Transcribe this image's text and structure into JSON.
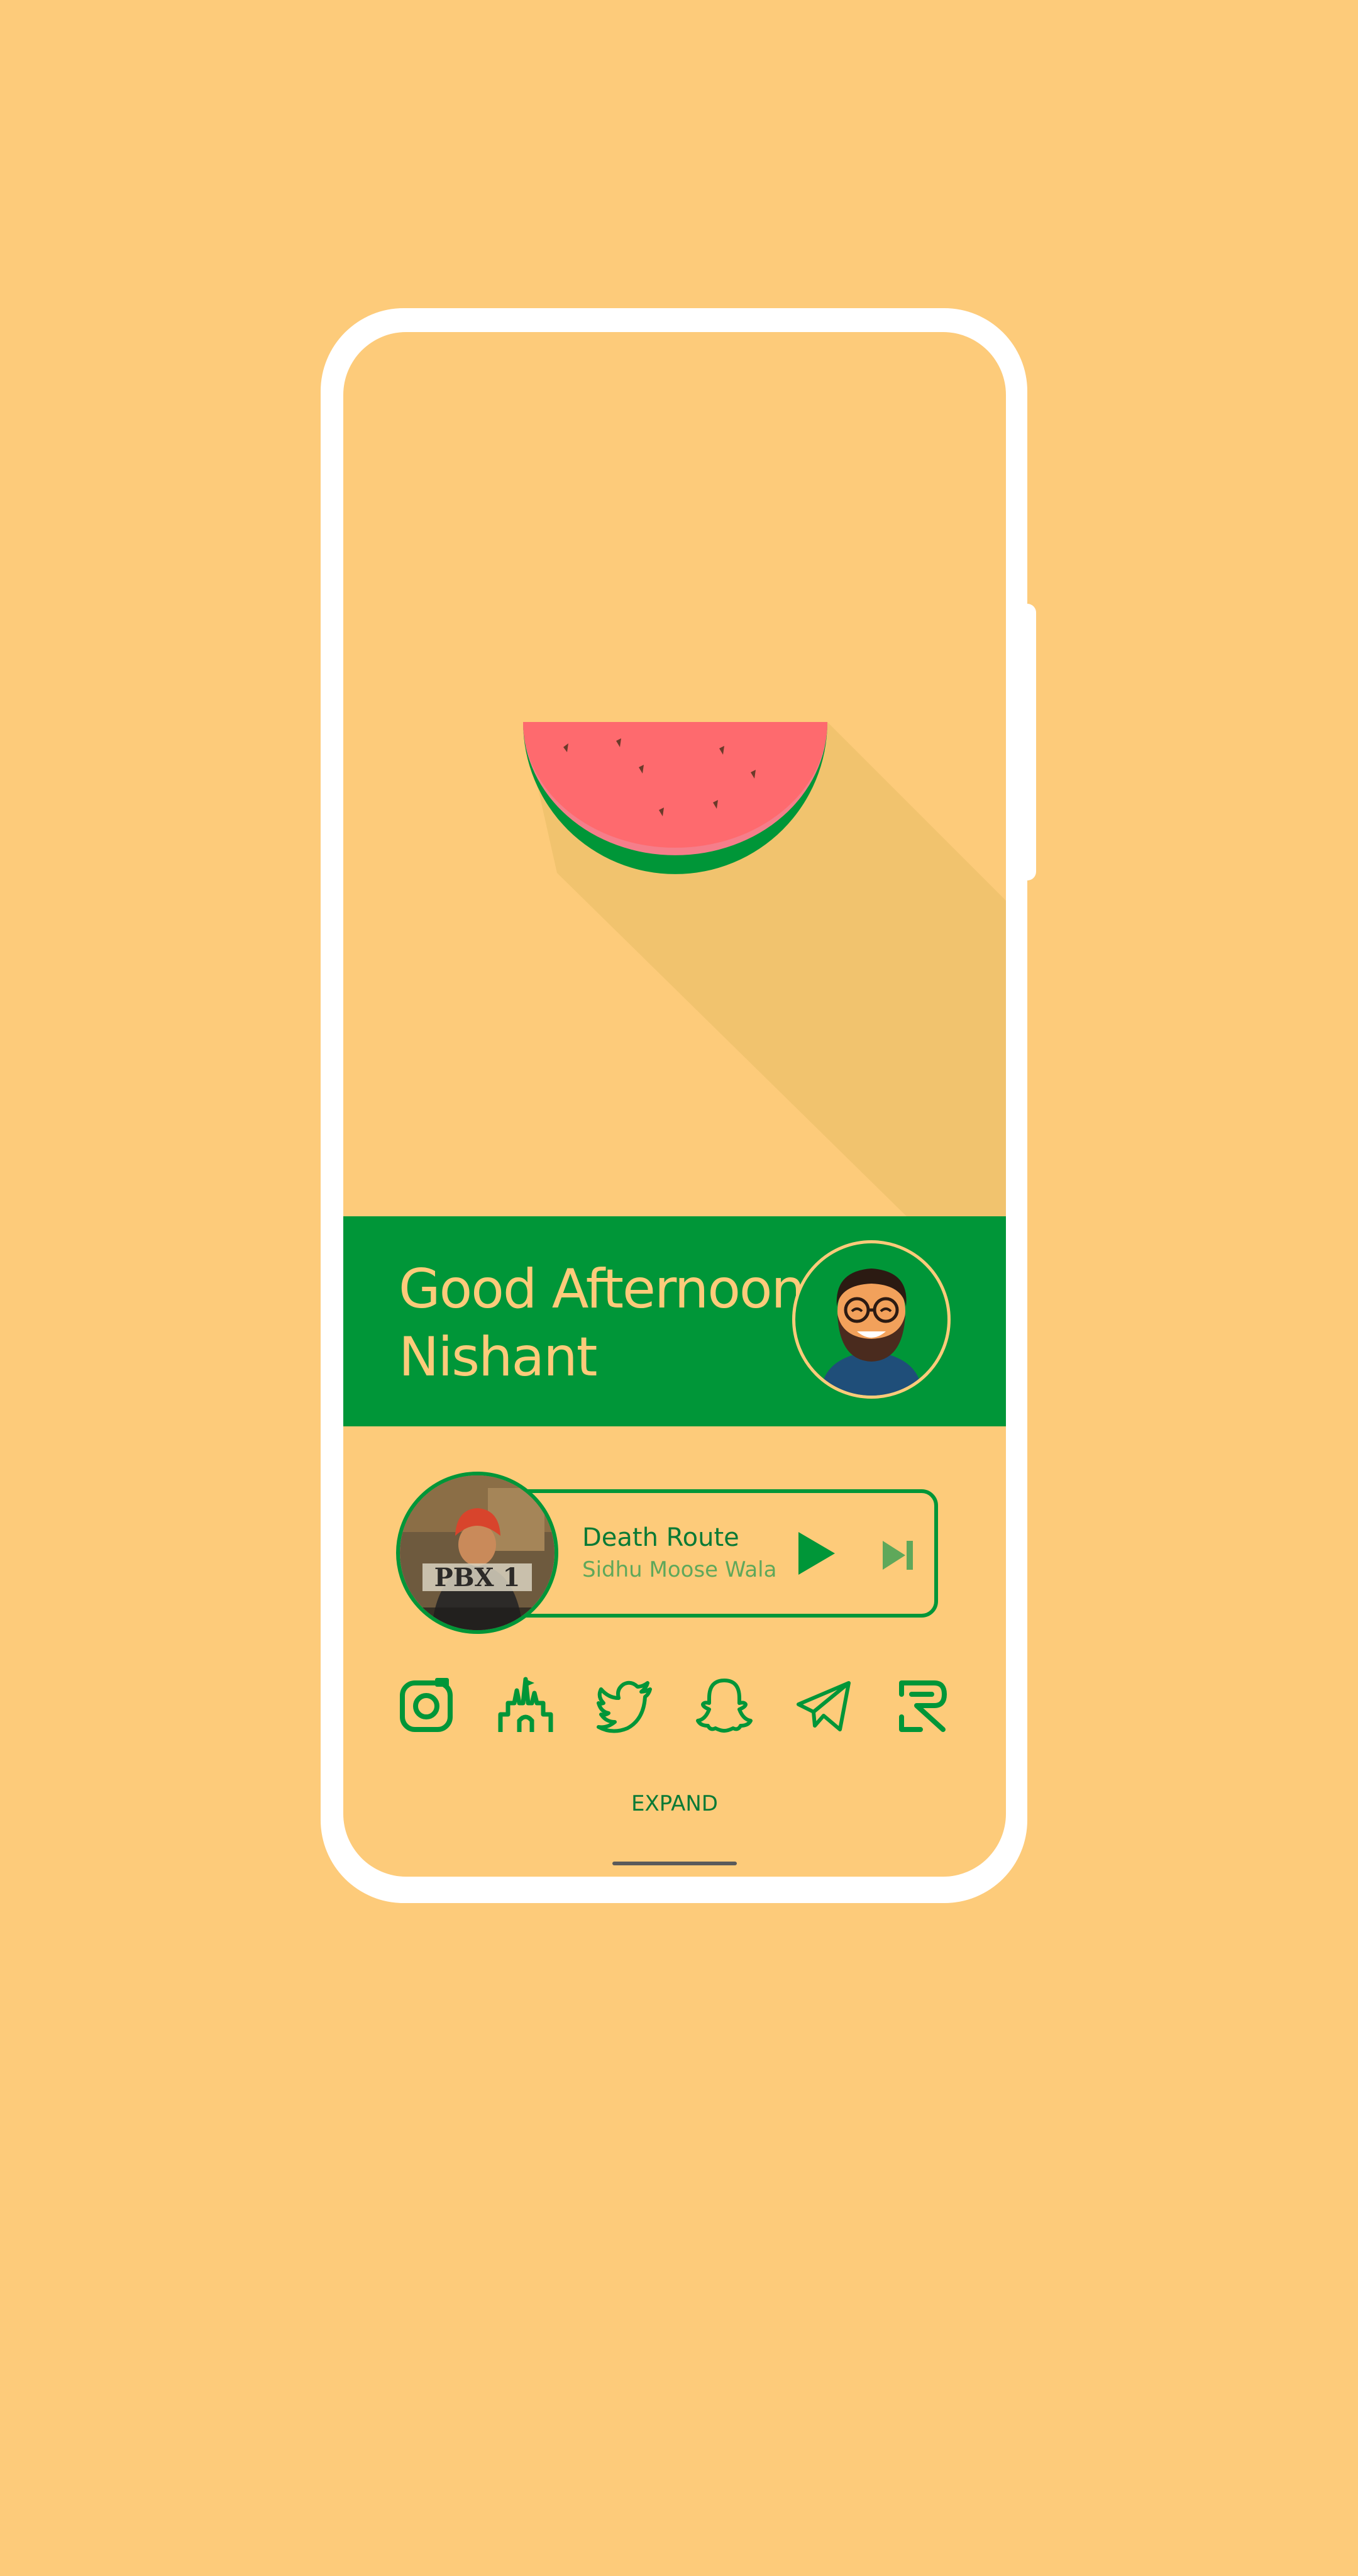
{
  "colors": {
    "background": "#FDCB7A",
    "accent_green": "#009638",
    "watermelon_flesh": "#FE6A6E",
    "frame": "#FFFFFF"
  },
  "greeting": {
    "line1": "Good Afternoon,",
    "line2": "Nishant"
  },
  "music": {
    "title": "Death Route",
    "artist": "Sidhu Moose Wala",
    "album_icon": "album-art-image",
    "play_icon": "play-icon",
    "next_icon": "skip-next-icon"
  },
  "dock": {
    "icons": [
      "instagram-icon",
      "castle-icon",
      "twitter-icon",
      "snapchat-icon",
      "telegram-icon",
      "reddit-r-icon"
    ]
  },
  "expand_label": "EXPAND"
}
